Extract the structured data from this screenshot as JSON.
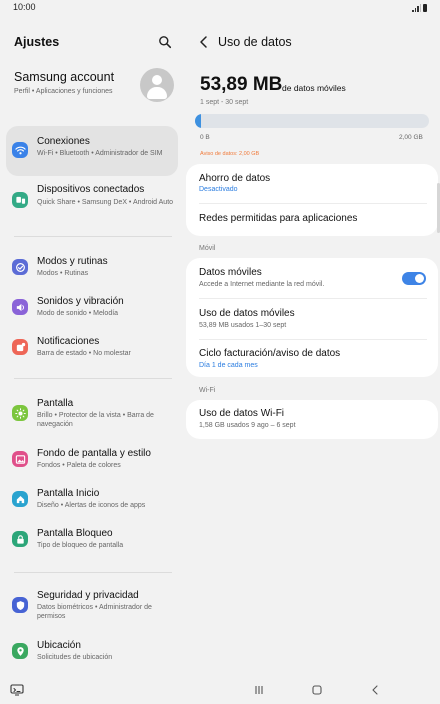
{
  "status_bar": {
    "time": "10:00"
  },
  "left": {
    "title": "Ajustes",
    "account": {
      "name": "Samsung account",
      "sub": "Perfil  •  Aplicaciones y funciones"
    },
    "items": [
      {
        "title": "Conexiones",
        "sub": "Wi-Fi  •  Bluetooth  •  Administrador de SIM",
        "icon": "wifi-icon",
        "color": "#3a82e8",
        "selected": true
      },
      {
        "title": "Dispositivos conectados",
        "sub": "Quick Share  •  Samsung DeX  •  Android Auto",
        "icon": "devices-icon",
        "color": "#33aa86"
      },
      {
        "title": "Modos y rutinas",
        "sub": "Modos  •  Rutinas",
        "icon": "modes-icon",
        "color": "#5c6cd6"
      },
      {
        "title": "Sonidos y vibración",
        "sub": "Modo de sonido  •  Melodía",
        "icon": "sound-icon",
        "color": "#8a63d8"
      },
      {
        "title": "Notificaciones",
        "sub": "Barra de estado  •  No molestar",
        "icon": "notification-icon",
        "color": "#ee6657"
      },
      {
        "title": "Pantalla",
        "sub": "Brillo  •  Protector de la vista  •  Barra de navegación",
        "icon": "display-icon",
        "color": "#7cc63e"
      },
      {
        "title": "Fondo de pantalla y estilo",
        "sub": "Fondos  •  Paleta de colores",
        "icon": "wallpaper-icon",
        "color": "#e0508a"
      },
      {
        "title": "Pantalla Inicio",
        "sub": "Diseño  •  Alertas de iconos de apps",
        "icon": "home-icon",
        "color": "#2aa3cf"
      },
      {
        "title": "Pantalla Bloqueo",
        "sub": "Tipo de bloqueo de pantalla",
        "icon": "lock-icon",
        "color": "#2ca679"
      },
      {
        "title": "Seguridad y privacidad",
        "sub": "Datos biométricos  •  Administrador de permisos",
        "icon": "shield-icon",
        "color": "#4763d4"
      },
      {
        "title": "Ubicación",
        "sub": "Solicitudes de ubicación",
        "icon": "location-icon",
        "color": "#3aa860"
      }
    ]
  },
  "right": {
    "title": "Uso de datos",
    "usage_value": "53,89 MB",
    "usage_unit": "de datos móviles",
    "range": "1 sept - 30 sept",
    "bar_min": "0 B",
    "bar_max": "2,00 GB",
    "bar_fraction": 0.026,
    "warning": "Aviso de datos: 2,00 GB",
    "saver": {
      "title": "Ahorro de datos",
      "sub": "Desactivado"
    },
    "allowed": {
      "title": "Redes permitidas para aplicaciones"
    },
    "section_mobile": "Móvil",
    "mobile_data": {
      "title": "Datos móviles",
      "sub": "Accede a Internet mediante la red móvil.",
      "enabled": true
    },
    "mobile_usage": {
      "title": "Uso de datos móviles",
      "sub": "53,89 MB usados 1–30 sept"
    },
    "billing": {
      "title": "Ciclo facturación/aviso de datos",
      "sub": "Día 1 de cada mes"
    },
    "section_wifi": "Wi-Fi",
    "wifi_usage": {
      "title": "Uso de datos Wi-Fi",
      "sub": "1,58 GB usados 9 ago – 6 sept"
    }
  }
}
